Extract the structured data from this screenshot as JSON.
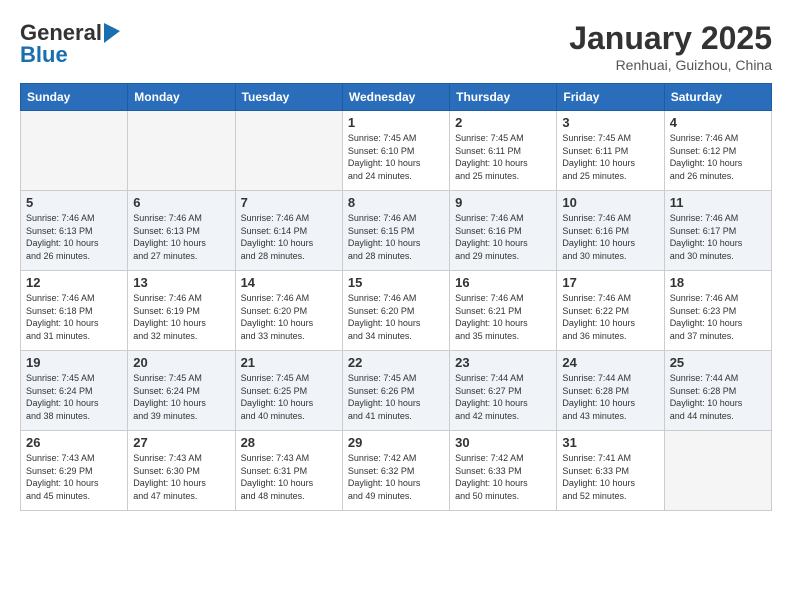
{
  "logo": {
    "general": "General",
    "blue": "Blue"
  },
  "title": "January 2025",
  "subtitle": "Renhuai, Guizhou, China",
  "weekdays": [
    "Sunday",
    "Monday",
    "Tuesday",
    "Wednesday",
    "Thursday",
    "Friday",
    "Saturday"
  ],
  "weeks": [
    [
      {
        "day": "",
        "info": ""
      },
      {
        "day": "",
        "info": ""
      },
      {
        "day": "",
        "info": ""
      },
      {
        "day": "1",
        "info": "Sunrise: 7:45 AM\nSunset: 6:10 PM\nDaylight: 10 hours\nand 24 minutes."
      },
      {
        "day": "2",
        "info": "Sunrise: 7:45 AM\nSunset: 6:11 PM\nDaylight: 10 hours\nand 25 minutes."
      },
      {
        "day": "3",
        "info": "Sunrise: 7:45 AM\nSunset: 6:11 PM\nDaylight: 10 hours\nand 25 minutes."
      },
      {
        "day": "4",
        "info": "Sunrise: 7:46 AM\nSunset: 6:12 PM\nDaylight: 10 hours\nand 26 minutes."
      }
    ],
    [
      {
        "day": "5",
        "info": "Sunrise: 7:46 AM\nSunset: 6:13 PM\nDaylight: 10 hours\nand 26 minutes."
      },
      {
        "day": "6",
        "info": "Sunrise: 7:46 AM\nSunset: 6:13 PM\nDaylight: 10 hours\nand 27 minutes."
      },
      {
        "day": "7",
        "info": "Sunrise: 7:46 AM\nSunset: 6:14 PM\nDaylight: 10 hours\nand 28 minutes."
      },
      {
        "day": "8",
        "info": "Sunrise: 7:46 AM\nSunset: 6:15 PM\nDaylight: 10 hours\nand 28 minutes."
      },
      {
        "day": "9",
        "info": "Sunrise: 7:46 AM\nSunset: 6:16 PM\nDaylight: 10 hours\nand 29 minutes."
      },
      {
        "day": "10",
        "info": "Sunrise: 7:46 AM\nSunset: 6:16 PM\nDaylight: 10 hours\nand 30 minutes."
      },
      {
        "day": "11",
        "info": "Sunrise: 7:46 AM\nSunset: 6:17 PM\nDaylight: 10 hours\nand 30 minutes."
      }
    ],
    [
      {
        "day": "12",
        "info": "Sunrise: 7:46 AM\nSunset: 6:18 PM\nDaylight: 10 hours\nand 31 minutes."
      },
      {
        "day": "13",
        "info": "Sunrise: 7:46 AM\nSunset: 6:19 PM\nDaylight: 10 hours\nand 32 minutes."
      },
      {
        "day": "14",
        "info": "Sunrise: 7:46 AM\nSunset: 6:20 PM\nDaylight: 10 hours\nand 33 minutes."
      },
      {
        "day": "15",
        "info": "Sunrise: 7:46 AM\nSunset: 6:20 PM\nDaylight: 10 hours\nand 34 minutes."
      },
      {
        "day": "16",
        "info": "Sunrise: 7:46 AM\nSunset: 6:21 PM\nDaylight: 10 hours\nand 35 minutes."
      },
      {
        "day": "17",
        "info": "Sunrise: 7:46 AM\nSunset: 6:22 PM\nDaylight: 10 hours\nand 36 minutes."
      },
      {
        "day": "18",
        "info": "Sunrise: 7:46 AM\nSunset: 6:23 PM\nDaylight: 10 hours\nand 37 minutes."
      }
    ],
    [
      {
        "day": "19",
        "info": "Sunrise: 7:45 AM\nSunset: 6:24 PM\nDaylight: 10 hours\nand 38 minutes."
      },
      {
        "day": "20",
        "info": "Sunrise: 7:45 AM\nSunset: 6:24 PM\nDaylight: 10 hours\nand 39 minutes."
      },
      {
        "day": "21",
        "info": "Sunrise: 7:45 AM\nSunset: 6:25 PM\nDaylight: 10 hours\nand 40 minutes."
      },
      {
        "day": "22",
        "info": "Sunrise: 7:45 AM\nSunset: 6:26 PM\nDaylight: 10 hours\nand 41 minutes."
      },
      {
        "day": "23",
        "info": "Sunrise: 7:44 AM\nSunset: 6:27 PM\nDaylight: 10 hours\nand 42 minutes."
      },
      {
        "day": "24",
        "info": "Sunrise: 7:44 AM\nSunset: 6:28 PM\nDaylight: 10 hours\nand 43 minutes."
      },
      {
        "day": "25",
        "info": "Sunrise: 7:44 AM\nSunset: 6:28 PM\nDaylight: 10 hours\nand 44 minutes."
      }
    ],
    [
      {
        "day": "26",
        "info": "Sunrise: 7:43 AM\nSunset: 6:29 PM\nDaylight: 10 hours\nand 45 minutes."
      },
      {
        "day": "27",
        "info": "Sunrise: 7:43 AM\nSunset: 6:30 PM\nDaylight: 10 hours\nand 47 minutes."
      },
      {
        "day": "28",
        "info": "Sunrise: 7:43 AM\nSunset: 6:31 PM\nDaylight: 10 hours\nand 48 minutes."
      },
      {
        "day": "29",
        "info": "Sunrise: 7:42 AM\nSunset: 6:32 PM\nDaylight: 10 hours\nand 49 minutes."
      },
      {
        "day": "30",
        "info": "Sunrise: 7:42 AM\nSunset: 6:33 PM\nDaylight: 10 hours\nand 50 minutes."
      },
      {
        "day": "31",
        "info": "Sunrise: 7:41 AM\nSunset: 6:33 PM\nDaylight: 10 hours\nand 52 minutes."
      },
      {
        "day": "",
        "info": ""
      }
    ]
  ]
}
